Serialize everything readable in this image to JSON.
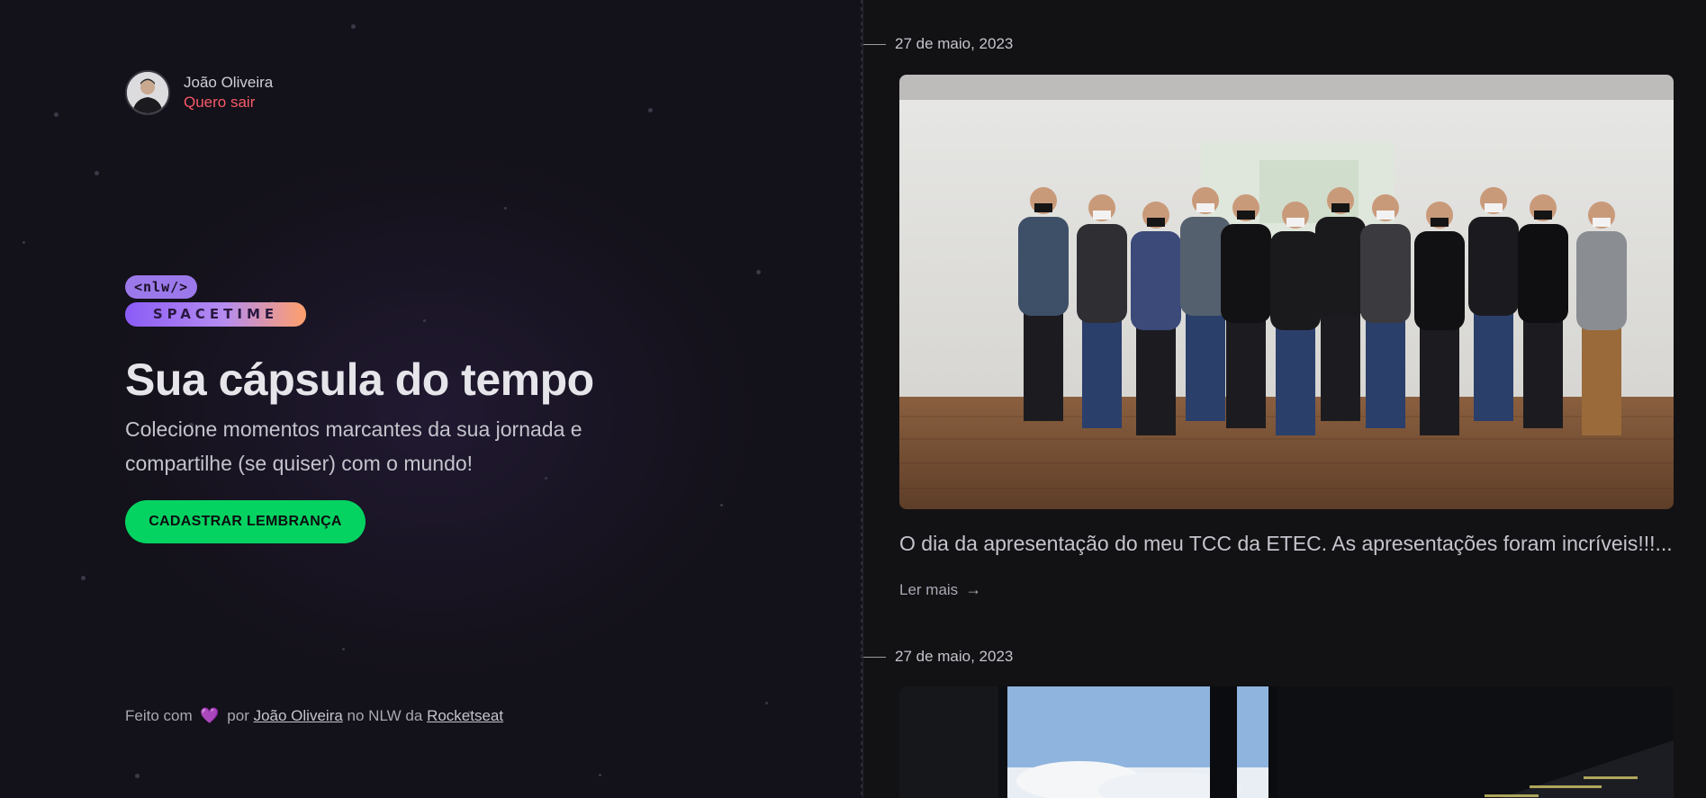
{
  "user": {
    "name": "João Oliveira",
    "logout_label": "Quero sair"
  },
  "brand": {
    "nlw_tag": "<nlw/>",
    "spacetime_tag": "SPACETIME"
  },
  "hero": {
    "title": "Sua cápsula do tempo",
    "subtitle": "Colecione momentos marcantes da sua jornada e compartilhe (se quiser) com o mundo!",
    "cta_label": "CADASTRAR LEMBRANÇA"
  },
  "footer": {
    "made_with": "Feito com",
    "heart_icon": "💜",
    "by": "por",
    "author": "João Oliveira",
    "at": "no NLW da",
    "company": "Rocketseat"
  },
  "memories": [
    {
      "date": "27 de maio, 2023",
      "excerpt": "O dia da apresentação do meu TCC da ETEC. As apresentações foram incríveis!!!...",
      "read_more": "Ler mais",
      "image": "group-photo"
    },
    {
      "date": "27 de maio, 2023",
      "image": "desk-photo"
    }
  ],
  "colors": {
    "accent_green": "#04d361",
    "logout_red": "#f75a68",
    "purple": "#9b79ea",
    "background": "#121215"
  }
}
